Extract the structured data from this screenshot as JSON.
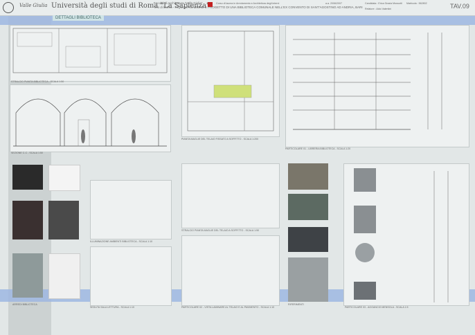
{
  "header": {
    "logo_text": "Valle Giulia",
    "university": "Università degli studi di Roma \"La Sapienza\"",
    "faculty": "Facoltà di Architettura \"Valle Giulia\"",
    "thesis": "Tesi di laurea - RIQUALIFICAZIONE E PROGETTO DI UNA BIBLIOTECA COMUNALE NELL'EX CONVENTO DI SANT'AGOSTINO AD ANDRIA, BARI",
    "course": "Corso di laurea in Arredamento e Architettura degli interni",
    "year": "a.a. 2006/2007",
    "candidate": "Candidata : Erica Grazia Mossotti",
    "matricola": "Matricola : 562802",
    "relatore": "Relatore : Aldo Valentini",
    "sheet": "TAV.09"
  },
  "section_title": "DETTAGLI BIBLIOTECA",
  "labels": {
    "pianta": "STRALCIO PIANTA BIBLIOTECA - SCALA 1:50",
    "sezione": "SEZIONE C-C - SCALA 1:50",
    "pianta_telaio": "PIANTA MAGLIE DEL TELAIO FISSATO A SOFFITTO - SCALA 1:200",
    "particolare1": "PARTICOLARE 01 - LIBRERIA BIBLIOTECA - SCALA 1:20",
    "arredi": "ARREDI BIBLIOTECA",
    "illuminazione": "ILLUMINAZIONE AMBIENTI BIBLIOTECA - SCALA 1:10",
    "seduta": "SEDUTA SALA LETTURA - SCALA 1:10",
    "stralcio_telaio": "STRALCIO PIANTA MAGLIE DEL TELAIO A SOFFITTO - SCALA 1:50",
    "particolare2": "PARTICOLARE 02 - VISTA LAMINARE AL TELAIO E AL PAVIMENTO - SCALA 1:10",
    "riferimenti": "RIFERIMENTI",
    "particolare3": "PARTICOLARE 03 - AGGANCIO MENSOLA - SCALA 1:5"
  }
}
